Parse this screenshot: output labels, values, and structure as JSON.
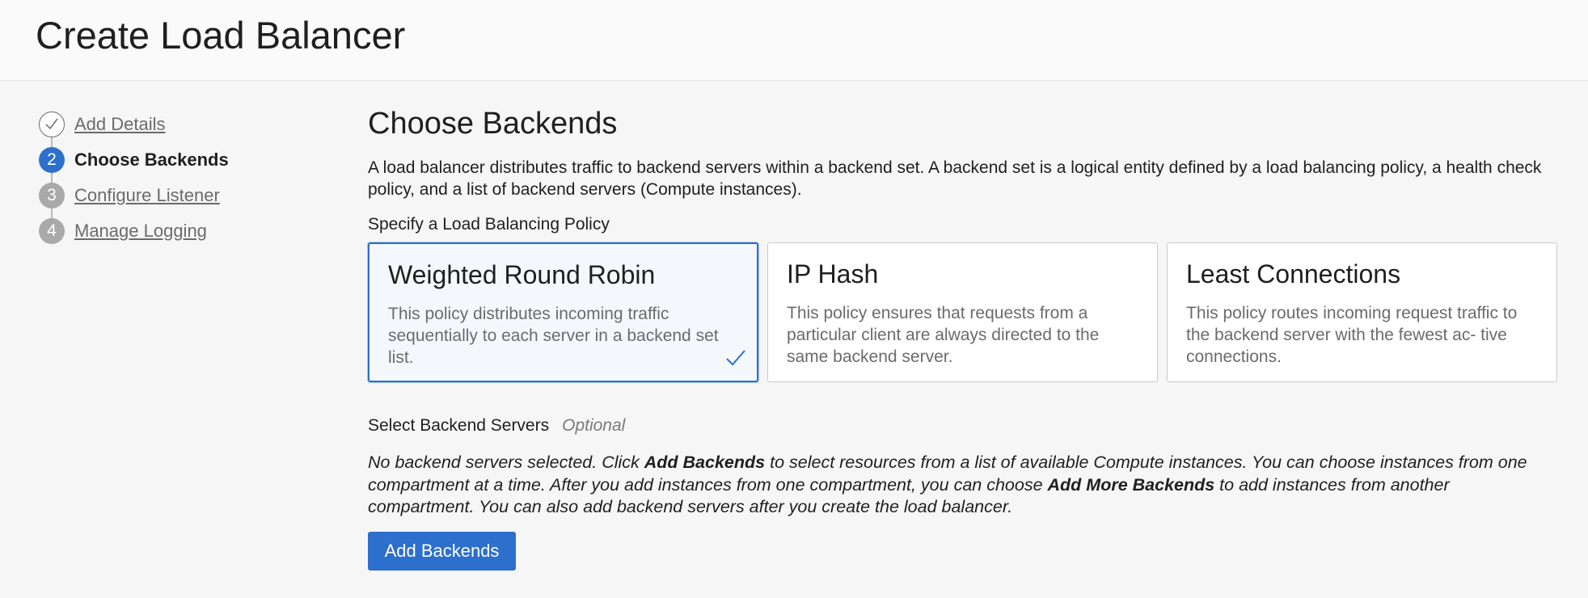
{
  "header": {
    "title": "Create Load Balancer"
  },
  "steps": [
    {
      "number": "",
      "label": "Add Details",
      "state": "done"
    },
    {
      "number": "2",
      "label": "Choose Backends",
      "state": "current"
    },
    {
      "number": "3",
      "label": "Configure Listener",
      "state": "todo"
    },
    {
      "number": "4",
      "label": "Manage Logging",
      "state": "todo"
    }
  ],
  "main": {
    "title": "Choose Backends",
    "intro": "A load balancer distributes traffic to backend servers within a backend set. A backend set is a logical entity defined by a load balancing policy, a health check policy, and a list of backend servers (Compute instances).",
    "policy_label": "Specify a Load Balancing Policy",
    "policies": [
      {
        "title": "Weighted Round Robin",
        "desc": "This policy distributes incoming traffic sequentially to each server in a backend set list.",
        "selected": true
      },
      {
        "title": "IP Hash",
        "desc": "This policy ensures that requests from a particular client are always directed to the same backend server.",
        "selected": false
      },
      {
        "title": "Least Connections",
        "desc": "This policy routes incoming request traffic to the backend server with the fewest ac- tive connections.",
        "selected": false
      }
    ],
    "servers_label": "Select Backend Servers",
    "servers_optional": "Optional",
    "servers_desc": {
      "part1": "No backend servers selected. Click ",
      "bold1": "Add Backends",
      "part2": " to select resources from a list of available Compute instances. You can choose instances from one compartment at a time. After you add instances from one compartment, you can choose ",
      "bold2": "Add More Backends",
      "part3": " to add instances from another compartment. You can also add backend servers after you create the load balancer."
    },
    "add_button": "Add Backends"
  },
  "colors": {
    "accent": "#2d6fcc",
    "selected_bg": "#f4f8fd"
  }
}
